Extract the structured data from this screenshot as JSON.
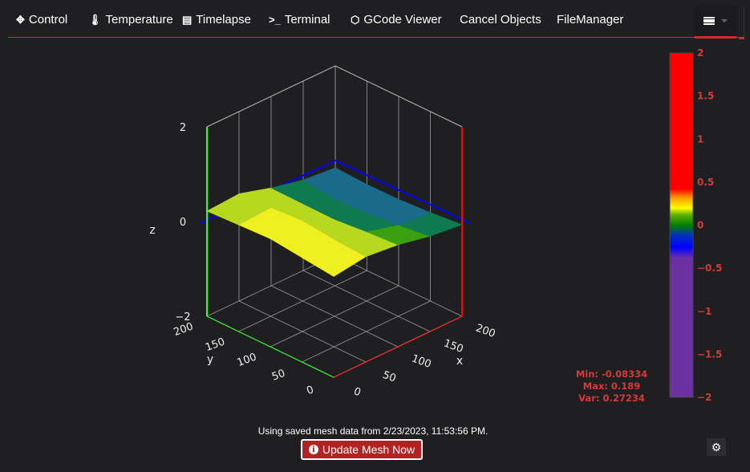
{
  "nav": {
    "tabs": [
      {
        "label": "Control",
        "icon": "arrows-icon"
      },
      {
        "label": "Temperature",
        "icon": "thermometer-icon"
      },
      {
        "label": "Timelapse",
        "icon": "film-icon"
      },
      {
        "label": "Terminal",
        "icon": "terminal-icon"
      },
      {
        "label": "GCode Viewer",
        "icon": "cube-icon"
      },
      {
        "label": "Cancel Objects",
        "icon": ""
      },
      {
        "label": "FileManager",
        "icon": ""
      }
    ],
    "menu_icon": "hamburger-icon"
  },
  "stats": {
    "min": "Min: -0.08334",
    "max": "Max: 0.189",
    "var": "Var: 0.27234"
  },
  "footer": {
    "note": "Using saved mesh data from 2/23/2023, 11:53:56 PM.",
    "update_label": "Update Mesh Now",
    "accent": "#b22222"
  },
  "chart_data": {
    "type": "surface",
    "title": "",
    "xlabel": "x",
    "ylabel": "y",
    "zlabel": "z",
    "x_ticks": [
      "0",
      "50",
      "100",
      "150",
      "200"
    ],
    "y_ticks": [
      "0",
      "50",
      "100",
      "150",
      "200"
    ],
    "z_ticks": [
      "−2",
      "0",
      "2"
    ],
    "xlim": [
      0,
      200
    ],
    "ylim": [
      0,
      200
    ],
    "zlim": [
      -2,
      2
    ],
    "grid": true,
    "x": [
      0,
      50,
      100,
      150,
      200
    ],
    "y": [
      0,
      50,
      100,
      150,
      200
    ],
    "z": [
      [
        0.12,
        0.15,
        0.1,
        0.02,
        -0.03
      ],
      [
        0.14,
        0.17,
        0.08,
        -0.02,
        -0.06
      ],
      [
        0.16,
        0.189,
        0.05,
        -0.05,
        -0.08
      ],
      [
        0.13,
        0.15,
        0.04,
        -0.06,
        -0.08334
      ],
      [
        0.1,
        0.12,
        0.03,
        -0.04,
        -0.07
      ]
    ],
    "colorbar": {
      "ticks": [
        "2",
        "1.5",
        "1",
        "0.5",
        "0",
        "−0.5",
        "−1",
        "−1.5",
        "−2"
      ],
      "range": [
        -2,
        2
      ],
      "colors": [
        "#6a32a0",
        "#0000ff",
        "#008000",
        "#ffff00",
        "#ff0000"
      ]
    }
  }
}
